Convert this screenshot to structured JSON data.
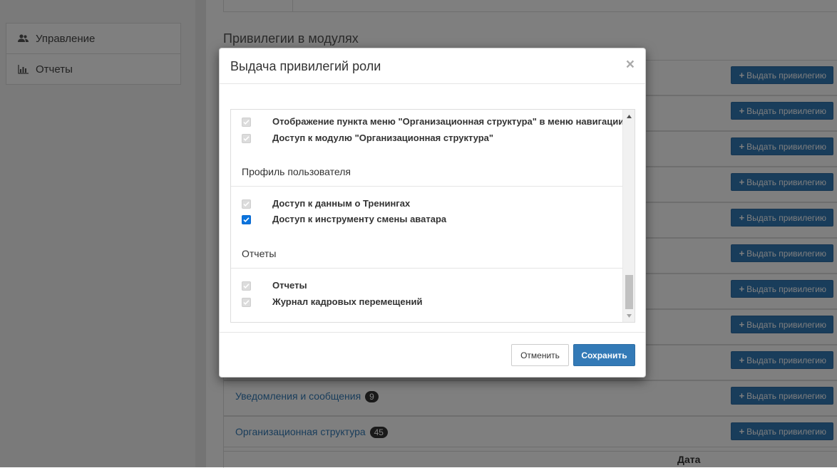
{
  "sidebar": {
    "items": [
      {
        "label": "Управление",
        "icon": "users-icon"
      },
      {
        "label": "Отчеты",
        "icon": "bar-chart-icon"
      }
    ]
  },
  "main": {
    "section_title": "Привилегии в модулях",
    "grant_button_label": "Выдать привилегию",
    "modules": [
      {
        "name": "Уведомления и сообщения",
        "count": "9"
      },
      {
        "name": "Организационная структура",
        "count": "45"
      }
    ],
    "table_header_date": "Дата"
  },
  "modal": {
    "title": "Выдача привилегий роли",
    "close_symbol": "×",
    "groups": [
      {
        "title": "",
        "items": [
          {
            "label": "Отображение пункта меню \"Организационная структура\" в меню навигации",
            "checked": true,
            "disabled": true
          },
          {
            "label": "Доступ к модулю \"Организационная структура\"",
            "checked": true,
            "disabled": true
          }
        ]
      },
      {
        "title": "Профиль пользователя",
        "items": [
          {
            "label": "Доступ к данным о Тренингах",
            "checked": true,
            "disabled": true
          },
          {
            "label": "Доступ к инструменту смены аватара",
            "checked": true,
            "disabled": false
          }
        ]
      },
      {
        "title": "Отчеты",
        "items": [
          {
            "label": "Отчеты",
            "checked": true,
            "disabled": true
          },
          {
            "label": "Журнал кадровых перемещений",
            "checked": true,
            "disabled": true
          }
        ]
      }
    ],
    "cancel_label": "Отменить",
    "save_label": "Сохранить"
  },
  "colors": {
    "primary": "#337ab7",
    "checkbox_active": "#0b74de",
    "checkbox_disabled": "#dcdcdc",
    "backdrop": "rgba(0,0,0,0.5)"
  }
}
